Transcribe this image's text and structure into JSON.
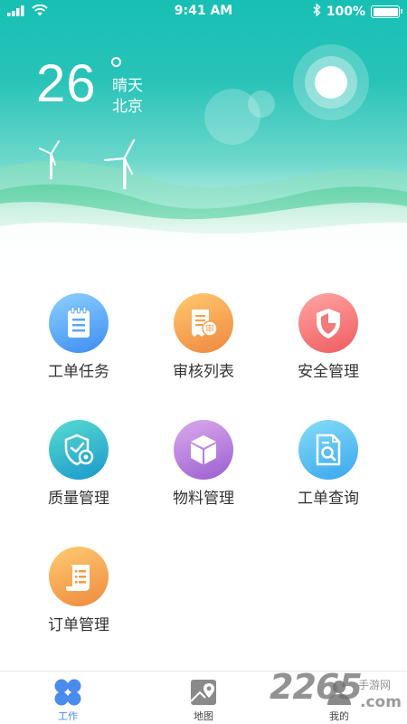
{
  "status_bar": {
    "time": "9:41 AM",
    "battery": "100%",
    "battery_level": 1.0,
    "icons": [
      "signal-icon",
      "wifi-icon",
      "bluetooth-icon",
      "battery-icon"
    ]
  },
  "weather": {
    "temperature": "26",
    "condition": "晴天",
    "city": "北京"
  },
  "grid": [
    {
      "label": "工单任务",
      "icon": "notepad-icon",
      "colors": [
        "#7ec9ff",
        "#3d8ff2"
      ]
    },
    {
      "label": "审核列表",
      "icon": "audit-document-icon",
      "colors": [
        "#ffc36b",
        "#f08a44"
      ]
    },
    {
      "label": "安全管理",
      "icon": "shield-icon",
      "colors": [
        "#ff9a98",
        "#f05b5e"
      ]
    },
    {
      "label": "质量管理",
      "icon": "quality-shield-gear-icon",
      "colors": [
        "#52d7cf",
        "#1aa8c9"
      ]
    },
    {
      "label": "物料管理",
      "icon": "box-icon",
      "colors": [
        "#d4a3e8",
        "#9b62d1"
      ]
    },
    {
      "label": "工单查询",
      "icon": "document-search-icon",
      "colors": [
        "#7fd9f7",
        "#3aa9ee"
      ]
    },
    {
      "label": "订单管理",
      "icon": "scroll-list-icon",
      "colors": [
        "#ffc870",
        "#f08c3e"
      ]
    }
  ],
  "tabbar": [
    {
      "label": "工作",
      "icon": "four-petal-icon",
      "active": true
    },
    {
      "label": "地图",
      "icon": "map-icon",
      "active": false
    },
    {
      "label": "我的",
      "icon": "user-icon",
      "active": false
    }
  ],
  "watermark": {
    "number": "2265",
    "name": "手游网",
    "domain": ".com"
  }
}
